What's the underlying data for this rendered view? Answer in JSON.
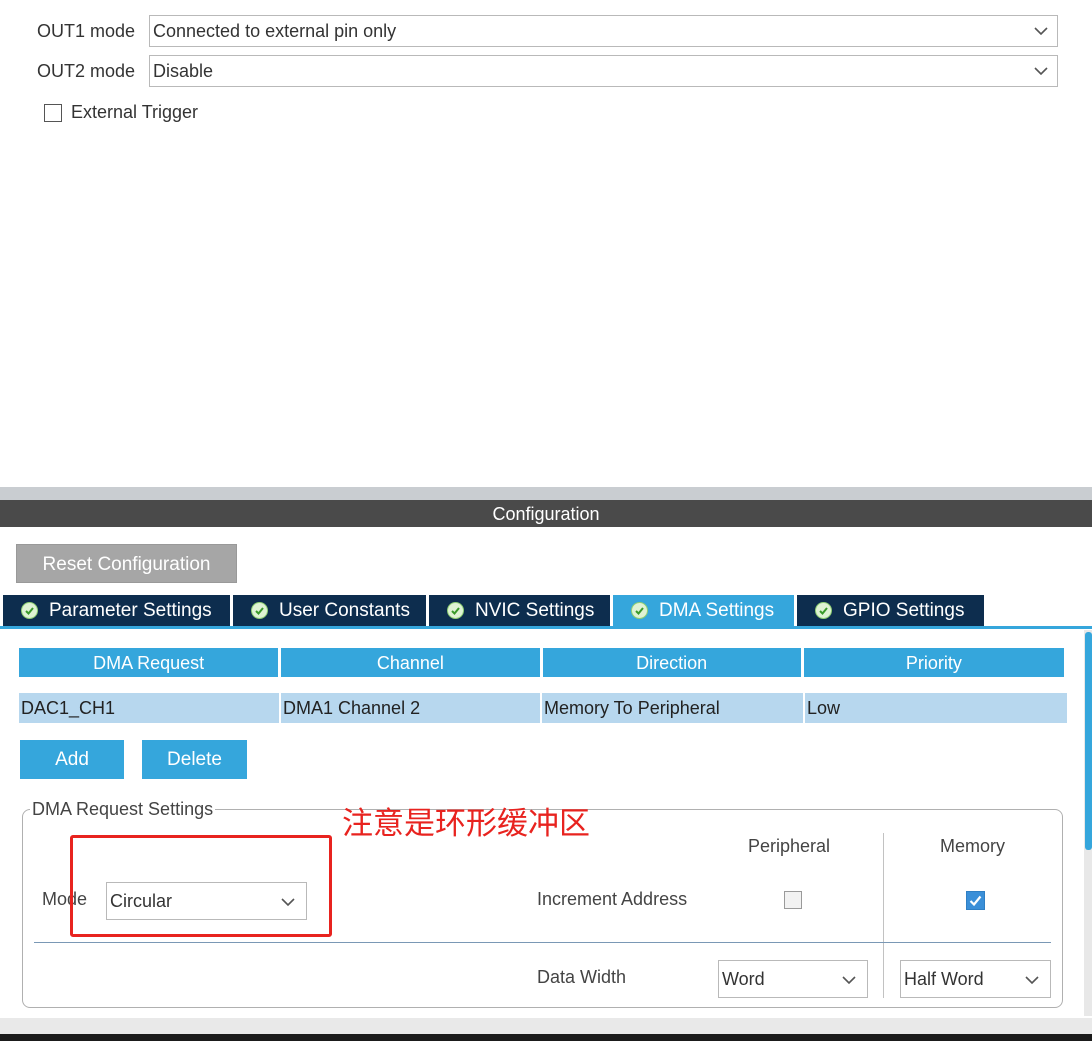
{
  "mode": {
    "out1": {
      "label": "OUT1 mode",
      "value": "Connected to external pin only"
    },
    "out2": {
      "label": "OUT2 mode",
      "value": "Disable"
    },
    "external_trigger": {
      "label": "External Trigger",
      "checked": false
    }
  },
  "config": {
    "header": "Configuration",
    "reset_button": "Reset Configuration",
    "tabs": [
      {
        "label": "Parameter Settings",
        "active": false
      },
      {
        "label": "User Constants",
        "active": false
      },
      {
        "label": "NVIC Settings",
        "active": false
      },
      {
        "label": "DMA Settings",
        "active": true
      },
      {
        "label": "GPIO Settings",
        "active": false
      }
    ],
    "dma_table": {
      "columns": [
        "DMA Request",
        "Channel",
        "Direction",
        "Priority"
      ],
      "rows": [
        [
          "DAC1_CH1",
          "DMA1 Channel 2",
          "Memory To Peripheral",
          "Low"
        ]
      ]
    },
    "add_button": "Add",
    "delete_button": "Delete",
    "request_settings": {
      "legend": "DMA Request Settings",
      "annotation": "注意是环形缓冲区",
      "mode_label": "Mode",
      "mode_value": "Circular",
      "peripheral_header": "Peripheral",
      "memory_header": "Memory",
      "increment_label": "Increment Address",
      "increment_peripheral": false,
      "increment_memory": true,
      "data_width_label": "Data Width",
      "data_width_peripheral": "Word",
      "data_width_memory": "Half Word"
    }
  },
  "colors": {
    "accent": "#35a6dc",
    "tab_dark": "#0d2d4e",
    "header_bar": "#4a4a4a",
    "annotation_red": "#e8231f",
    "table_row": "#b7d7ee"
  },
  "icons": [
    "chevron-down-icon",
    "check-circle-icon",
    "checkbox-icon",
    "check-icon"
  ]
}
